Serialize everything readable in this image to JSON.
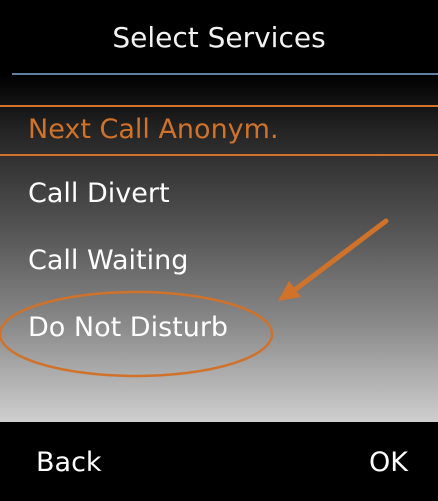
{
  "header": {
    "title": "Select Services"
  },
  "menu": {
    "items": [
      {
        "label": "Next Call Anonym.",
        "selected": true
      },
      {
        "label": "Call Divert",
        "selected": false
      },
      {
        "label": "Call Waiting",
        "selected": false
      },
      {
        "label": "Do Not Disturb",
        "selected": false
      }
    ]
  },
  "softkeys": {
    "left_label": "Back",
    "right_label": "OK"
  },
  "colors": {
    "accent": "#d0722a",
    "header_divider": "#5f7fa6"
  },
  "annotation": {
    "highlighted_item": "Do Not Disturb",
    "arrow_icon": "arrow-icon",
    "highlight_shape": "ellipse"
  }
}
